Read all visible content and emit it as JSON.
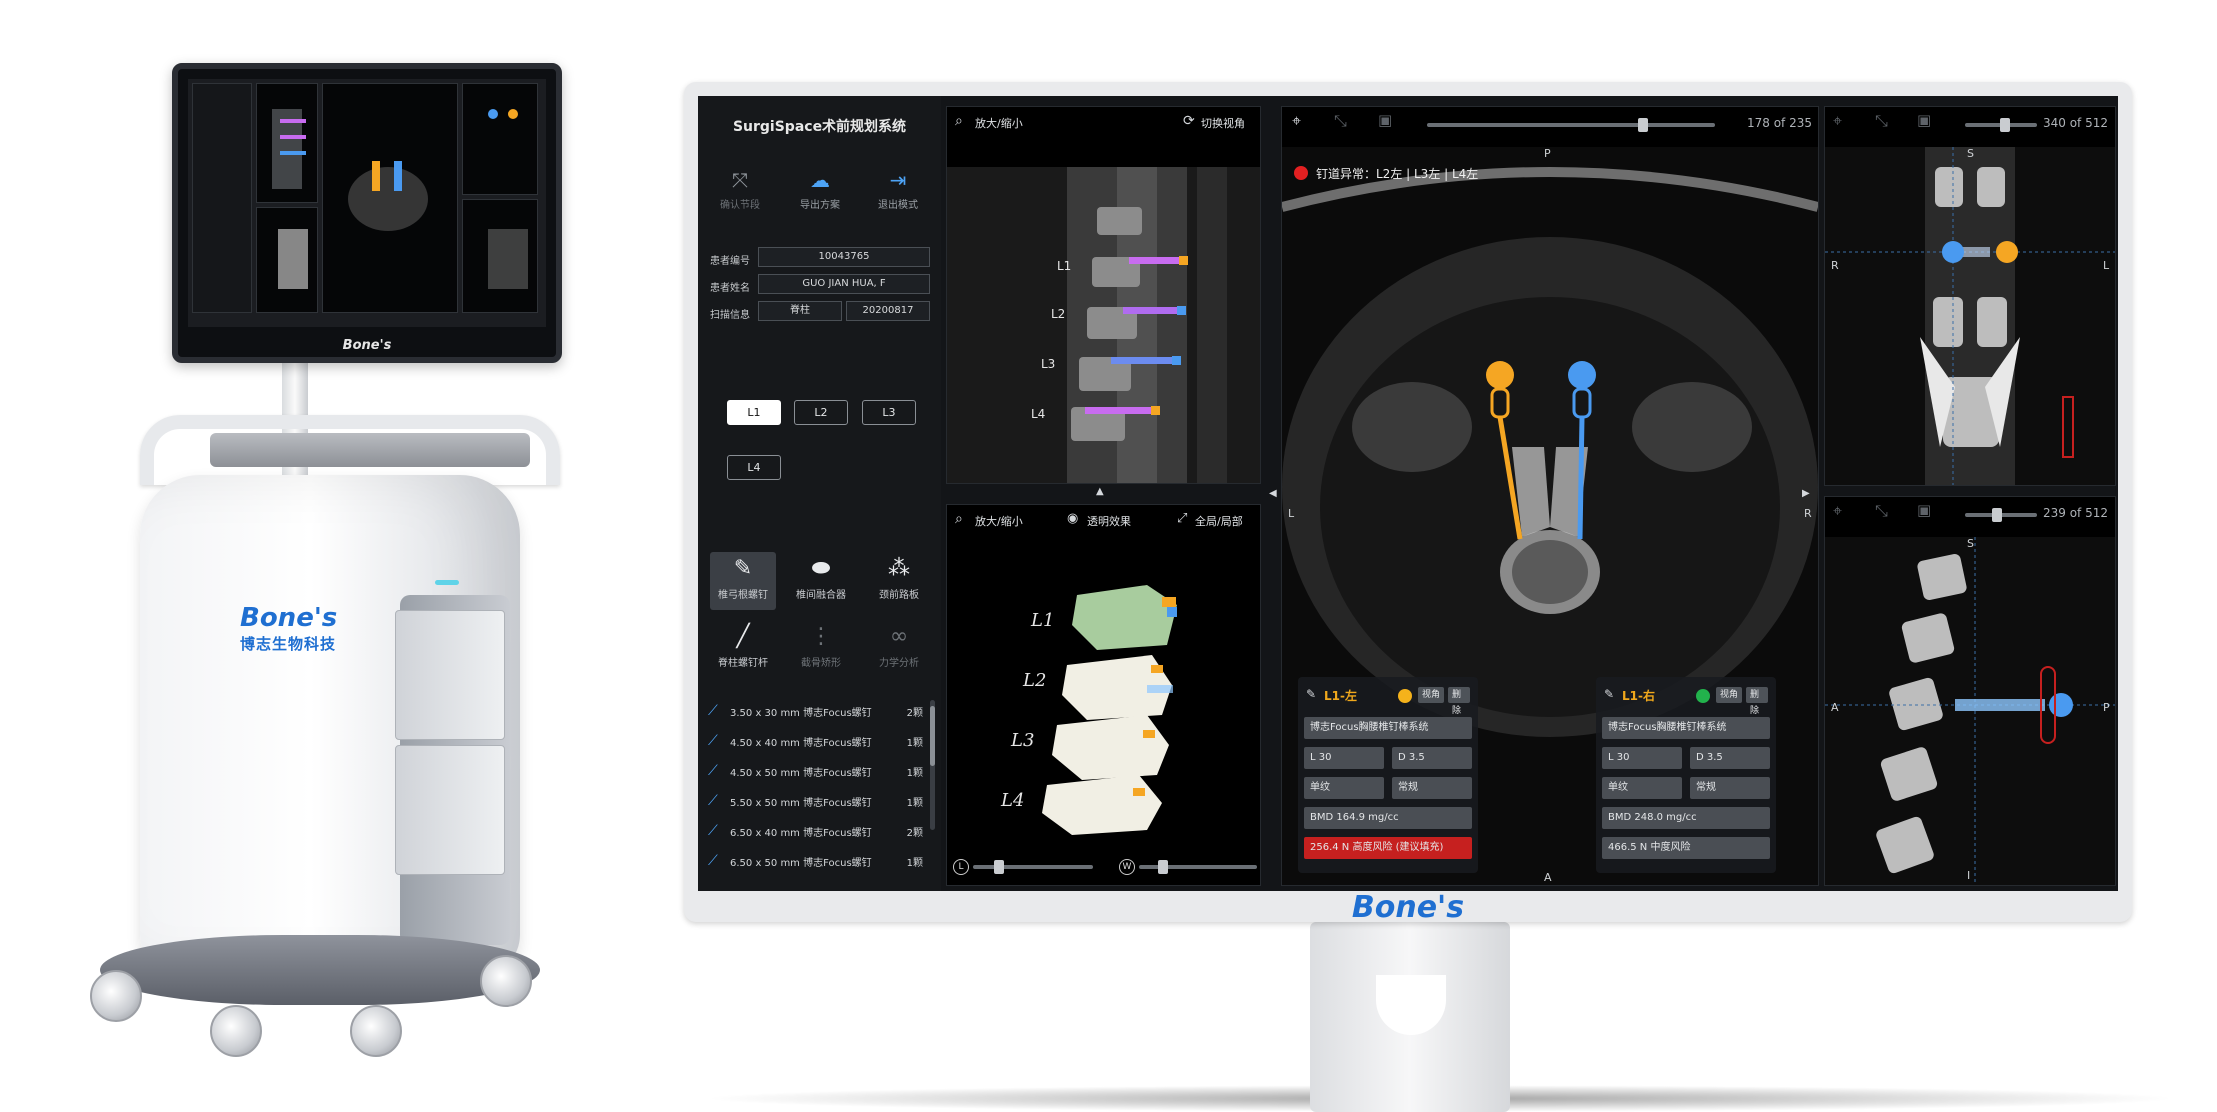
{
  "cart": {
    "brand": "Bone's",
    "brand_cn": "博志生物科技",
    "mini_logo": "Bone's"
  },
  "monitor": {
    "bezel_logo": "Bone's"
  },
  "sidebar": {
    "title": "SurgiSpace术前规划系统",
    "tools": [
      {
        "label": "确认节段",
        "icon": "collapse-arrows-icon"
      },
      {
        "label": "导出方案",
        "icon": "cloud-upload-icon"
      },
      {
        "label": "退出模式",
        "icon": "exit-icon"
      }
    ],
    "patient": {
      "id_label": "患者编号",
      "id_value": "10043765",
      "name_label": "患者姓名",
      "name_value": "GUO JIAN HUA, F",
      "scan_label": "扫描信息",
      "scan_part": "脊柱",
      "scan_date": "20200817"
    },
    "levels": [
      "L1",
      "L2",
      "L3",
      "L4"
    ],
    "implants": [
      {
        "label": "椎弓根螺钉",
        "icon": "screw-icon"
      },
      {
        "label": "椎间融合器",
        "icon": "cage-icon"
      },
      {
        "label": "颈前路板",
        "icon": "plate-icon"
      },
      {
        "label": "脊柱螺钉杆",
        "icon": "rod-icon"
      },
      {
        "label": "截骨矫形",
        "icon": "spine-icon"
      },
      {
        "label": "力学分析",
        "icon": "link-icon"
      }
    ],
    "screws": [
      {
        "name": "3.50 x 30 mm 博志Focus螺钉",
        "count": "2颗"
      },
      {
        "name": "4.50 x 40 mm 博志Focus螺钉",
        "count": "1颗"
      },
      {
        "name": "4.50 x 50 mm 博志Focus螺钉",
        "count": "1颗"
      },
      {
        "name": "5.50 x 50 mm 博志Focus螺钉",
        "count": "1颗"
      },
      {
        "name": "6.50 x 40 mm 博志Focus螺钉",
        "count": "2颗"
      },
      {
        "name": "6.50 x 50 mm 博志Focus螺钉",
        "count": "1颗"
      }
    ]
  },
  "sagittal_view": {
    "zoom_label": "放大/缩小",
    "switch_label": "切换视角",
    "levels": [
      "L1",
      "L2",
      "L3",
      "L4"
    ]
  },
  "model_view": {
    "zoom_label": "放大/缩小",
    "transparency_label": "透明效果",
    "global_label": "全局/局部",
    "levels": [
      "L1",
      "L2",
      "L3",
      "L4"
    ],
    "l_label": "L",
    "w_label": "W",
    "l_slider": 0.22,
    "w_slider": 0.2
  },
  "axial_view": {
    "counter": "178 of 235",
    "slider": 0.75,
    "orient_top": "P",
    "orient_bottom": "A",
    "orient_left": "L",
    "orient_right": "R",
    "alert": "钉道异常：L2左 | L3左 | L4左",
    "left_card": {
      "title": "L1-左",
      "dot_color": "#f5b21b",
      "view_btn": "视角",
      "del_btn": "删除",
      "system": "博志Focus胸腰椎钉棒系统",
      "length": "L 30",
      "diameter": "D 3.5",
      "thread": "单纹",
      "type": "常规",
      "bmd": "BMD 164.9 mg/cc",
      "force": "256.4 N  高度风险 (建议填充)"
    },
    "right_card": {
      "title": "L1-右",
      "dot_color": "#22b24c",
      "view_btn": "视角",
      "del_btn": "删除",
      "system": "博志Focus胸腰椎钉棒系统",
      "length": "L 30",
      "diameter": "D 3.5",
      "thread": "单纹",
      "type": "常规",
      "bmd": "BMD 248.0 mg/cc",
      "force": "466.5 N  中度风险"
    }
  },
  "coronal_view": {
    "counter": "340 of 512",
    "slider": 0.55,
    "orient_top": "S",
    "orient_left": "R",
    "orient_right": "L"
  },
  "sagittal_ct_view": {
    "counter": "239 of 512",
    "slider": 0.45,
    "orient_top": "S",
    "orient_left": "A",
    "orient_right": "P",
    "orient_bottom": "I"
  },
  "colors": {
    "screw_left": "#f5a623",
    "screw_right": "#4a9af0",
    "alert": "#e32021",
    "brand": "#1f6fd1"
  }
}
